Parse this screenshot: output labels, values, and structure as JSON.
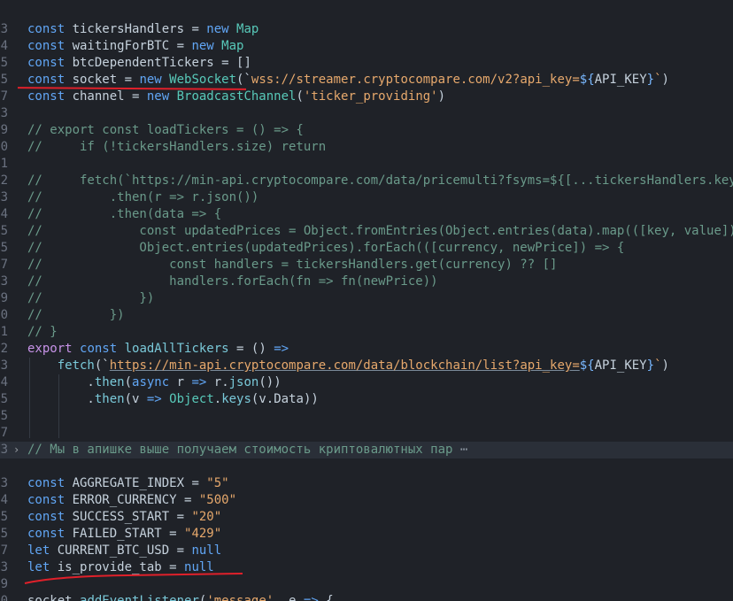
{
  "editor": {
    "lines": [
      {
        "n": "3",
        "segs": [
          [
            "kw",
            "const "
          ],
          [
            "id",
            "tickersHandlers "
          ],
          [
            "pun",
            "= "
          ],
          [
            "kw",
            "new "
          ],
          [
            "cls",
            "Map"
          ]
        ]
      },
      {
        "n": "4",
        "segs": [
          [
            "kw",
            "const "
          ],
          [
            "id",
            "waitingForBTC "
          ],
          [
            "pun",
            "= "
          ],
          [
            "kw",
            "new "
          ],
          [
            "cls",
            "Map"
          ]
        ]
      },
      {
        "n": "5",
        "segs": [
          [
            "kw",
            "const "
          ],
          [
            "id",
            "btcDependentTickers "
          ],
          [
            "pun",
            "= []"
          ]
        ]
      },
      {
        "n": "5",
        "segs": [
          [
            "kw",
            "const "
          ],
          [
            "id",
            "socket "
          ],
          [
            "pun",
            "= "
          ],
          [
            "kw",
            "new "
          ],
          [
            "cls",
            "WebSocket"
          ],
          [
            "pun",
            "(`"
          ],
          [
            "str",
            "wss://streamer.cryptocompare.com/v2?api_key="
          ],
          [
            "tpl",
            "${"
          ],
          [
            "id",
            "API_KEY"
          ],
          [
            "tpl",
            "}"
          ],
          [
            "str",
            "`"
          ],
          [
            "pun",
            ")"
          ]
        ]
      },
      {
        "n": "7",
        "segs": [
          [
            "kw",
            "const "
          ],
          [
            "id",
            "channel "
          ],
          [
            "pun",
            "= "
          ],
          [
            "kw",
            "new "
          ],
          [
            "cls",
            "BroadcastChannel"
          ],
          [
            "pun",
            "("
          ],
          [
            "str",
            "'ticker_providing'"
          ],
          [
            "pun",
            ")"
          ]
        ]
      },
      {
        "n": "3",
        "segs": []
      },
      {
        "n": "9",
        "segs": [
          [
            "cm",
            "// export const loadTickers = () => {"
          ]
        ]
      },
      {
        "n": "0",
        "segs": [
          [
            "cm",
            "//     if (!tickersHandlers.size) return"
          ]
        ]
      },
      {
        "n": "1",
        "segs": []
      },
      {
        "n": "2",
        "segs": [
          [
            "cm",
            "//     fetch(`https://min-api.cryptocompare.com/data/pricemulti?fsyms=${[...tickersHandlers.keys()"
          ]
        ]
      },
      {
        "n": "3",
        "segs": [
          [
            "cm",
            "//         .then(r => r.json())"
          ]
        ]
      },
      {
        "n": "4",
        "segs": [
          [
            "cm",
            "//         .then(data => {"
          ]
        ]
      },
      {
        "n": "5",
        "segs": [
          [
            "cm",
            "//             const updatedPrices = Object.fromEntries(Object.entries(data).map(([key, value]) =>"
          ]
        ]
      },
      {
        "n": "5",
        "segs": [
          [
            "cm",
            "//             Object.entries(updatedPrices).forEach(([currency, newPrice]) => {"
          ]
        ]
      },
      {
        "n": "7",
        "segs": [
          [
            "cm",
            "//                 const handlers = tickersHandlers.get(currency) ?? []"
          ]
        ]
      },
      {
        "n": "3",
        "segs": [
          [
            "cm",
            "//                 handlers.forEach(fn => fn(newPrice))"
          ]
        ]
      },
      {
        "n": "9",
        "segs": [
          [
            "cm",
            "//             })"
          ]
        ]
      },
      {
        "n": "0",
        "segs": [
          [
            "cm",
            "//         })"
          ]
        ]
      },
      {
        "n": "1",
        "segs": [
          [
            "cm",
            "// }"
          ]
        ]
      },
      {
        "n": "2",
        "segs": [
          [
            "kw2",
            "export "
          ],
          [
            "kw",
            "const "
          ],
          [
            "fn",
            "loadAllTickers "
          ],
          [
            "pun",
            "= () "
          ],
          [
            "kw",
            "=>"
          ]
        ]
      },
      {
        "n": "3",
        "segs": [
          [
            "pun",
            "    "
          ],
          [
            "fn",
            "fetch"
          ],
          [
            "pun",
            "(`"
          ],
          [
            "url",
            "https://min-api.cryptocompare.com/data/blockchain/list?api_key="
          ],
          [
            "tpl",
            "${"
          ],
          [
            "id",
            "API_KEY"
          ],
          [
            "tpl",
            "}"
          ],
          [
            "str",
            "`"
          ],
          [
            "pun",
            ")"
          ]
        ]
      },
      {
        "n": "4",
        "segs": [
          [
            "pun",
            "        ."
          ],
          [
            "fn",
            "then"
          ],
          [
            "pun",
            "("
          ],
          [
            "kw",
            "async "
          ],
          [
            "id",
            "r "
          ],
          [
            "kw",
            "=> "
          ],
          [
            "id",
            "r"
          ],
          [
            "pun",
            "."
          ],
          [
            "fn",
            "json"
          ],
          [
            "pun",
            "())"
          ]
        ]
      },
      {
        "n": "5",
        "segs": [
          [
            "pun",
            "        ."
          ],
          [
            "fn",
            "then"
          ],
          [
            "pun",
            "("
          ],
          [
            "id",
            "v "
          ],
          [
            "kw",
            "=> "
          ],
          [
            "cls",
            "Object"
          ],
          [
            "pun",
            "."
          ],
          [
            "fn",
            "keys"
          ],
          [
            "pun",
            "("
          ],
          [
            "id",
            "v"
          ],
          [
            "pun",
            "."
          ],
          [
            "id",
            "Data"
          ],
          [
            "pun",
            "))"
          ]
        ]
      },
      {
        "n": "5",
        "segs": []
      },
      {
        "n": "7",
        "segs": []
      },
      {
        "n": "3",
        "fold": true,
        "hl": true,
        "segs": [
          [
            "cm",
            "// Мы в апишке выше получаем стоимость криптовалютных пар"
          ],
          [
            "dots",
            " ⋯"
          ]
        ]
      },
      {
        "n": "",
        "segs": []
      },
      {
        "n": "3",
        "segs": [
          [
            "kw",
            "const "
          ],
          [
            "id",
            "AGGREGATE_INDEX "
          ],
          [
            "pun",
            "= "
          ],
          [
            "str",
            "\"5\""
          ]
        ]
      },
      {
        "n": "4",
        "segs": [
          [
            "kw",
            "const "
          ],
          [
            "id",
            "ERROR_CURRENCY "
          ],
          [
            "pun",
            "= "
          ],
          [
            "str",
            "\"500\""
          ]
        ]
      },
      {
        "n": "5",
        "segs": [
          [
            "kw",
            "const "
          ],
          [
            "id",
            "SUCCESS_START "
          ],
          [
            "pun",
            "= "
          ],
          [
            "str",
            "\"20\""
          ]
        ]
      },
      {
        "n": "5",
        "segs": [
          [
            "kw",
            "const "
          ],
          [
            "id",
            "FAILED_START "
          ],
          [
            "pun",
            "= "
          ],
          [
            "str",
            "\"429\""
          ]
        ]
      },
      {
        "n": "7",
        "segs": [
          [
            "kw",
            "let "
          ],
          [
            "id",
            "CURRENT_BTC_USD "
          ],
          [
            "pun",
            "= "
          ],
          [
            "kw",
            "null"
          ]
        ]
      },
      {
        "n": "3",
        "segs": [
          [
            "kw",
            "let "
          ],
          [
            "id",
            "is_provide_tab "
          ],
          [
            "pun",
            "= "
          ],
          [
            "kw",
            "null"
          ]
        ]
      },
      {
        "n": "9",
        "segs": []
      },
      {
        "n": "0",
        "segs": [
          [
            "id",
            "socket"
          ],
          [
            "pun",
            "."
          ],
          [
            "fn",
            "addEventListener"
          ],
          [
            "pun",
            "("
          ],
          [
            "str",
            "'message'"
          ],
          [
            "pun",
            ", "
          ],
          [
            "id",
            "e "
          ],
          [
            "kw",
            "=> "
          ],
          [
            "pun",
            "{"
          ]
        ]
      }
    ]
  }
}
